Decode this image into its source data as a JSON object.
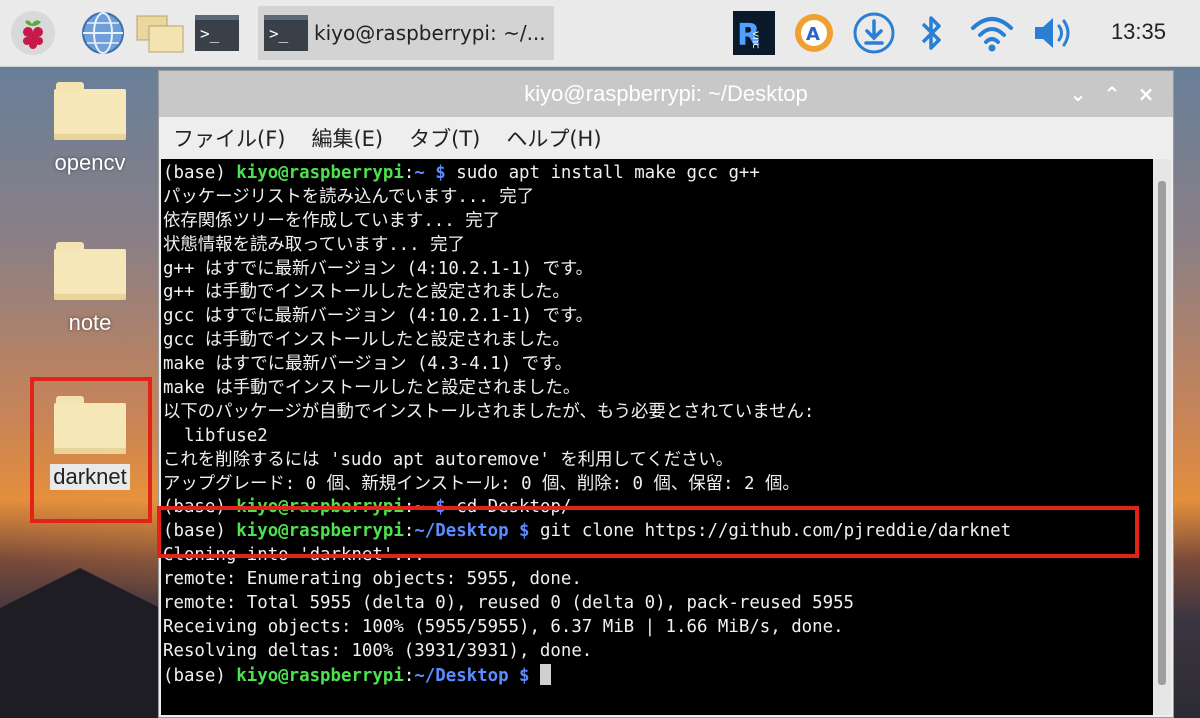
{
  "taskbar": {
    "active_window_label": "kiyo@raspberrypi: ~/...",
    "clock": "13:35",
    "terminal_glyph": ">_"
  },
  "desktop": {
    "icons": [
      {
        "label": "opencv"
      },
      {
        "label": "note"
      },
      {
        "label": "darknet"
      }
    ]
  },
  "window": {
    "title": "kiyo@raspberrypi: ~/Desktop",
    "menu": [
      "ファイル(F)",
      "編集(E)",
      "タブ(T)",
      "ヘルプ(H)"
    ],
    "controls": {
      "minimize": "⌄",
      "maximize": "⌃",
      "close": "×"
    }
  },
  "terminal": {
    "prompt": {
      "base": "(base) ",
      "user_host": "kiyo@raspberrypi",
      "colon": ":",
      "home": "~",
      "desktop": "~/Desktop",
      "dollar": " $ "
    },
    "lines": {
      "cmd1": "sudo apt install make gcc g++",
      "l1": "パッケージリストを読み込んでいます... 完了",
      "l2": "依存関係ツリーを作成しています... 完了",
      "l3": "状態情報を読み取っています... 完了",
      "l4": "g++ はすでに最新バージョン (4:10.2.1-1) です。",
      "l5": "g++ は手動でインストールしたと設定されました。",
      "l6": "gcc はすでに最新バージョン (4:10.2.1-1) です。",
      "l7": "gcc は手動でインストールしたと設定されました。",
      "l8": "make はすでに最新バージョン (4.3-4.1) です。",
      "l9": "make は手動でインストールしたと設定されました。",
      "l10": "以下のパッケージが自動でインストールされましたが、もう必要とされていません:",
      "l11": "  libfuse2",
      "l12": "これを削除するには 'sudo apt autoremove' を利用してください。",
      "l13": "アップグレード: 0 個、新規インストール: 0 個、削除: 0 個、保留: 2 個。",
      "cmd2": "cd Desktop/",
      "cmd3": "git clone https://github.com/pjreddie/darknet",
      "l14": "Cloning into 'darknet'...",
      "l15": "remote: Enumerating objects: 5955, done.",
      "l16": "remote: Total 5955 (delta 0), reused 0 (delta 0), pack-reused 5955",
      "l17": "Receiving objects: 100% (5955/5955), 6.37 MiB | 1.66 MiB/s, done.",
      "l18": "Resolving deltas: 100% (3931/3931), done."
    }
  },
  "colors": {
    "prompt_user": "#4ee14e",
    "prompt_path": "#5c8cff",
    "highlight_box": "#e2231a"
  }
}
